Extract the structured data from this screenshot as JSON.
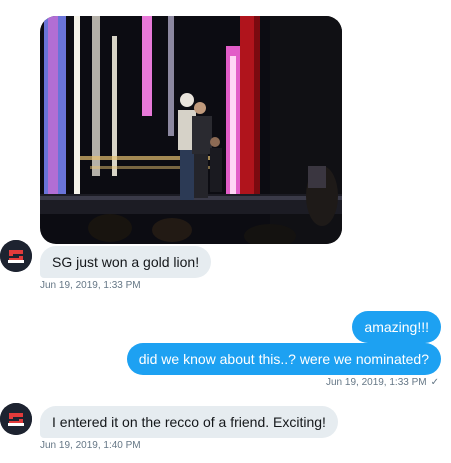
{
  "colors": {
    "incoming_bubble": "#e6ecf0",
    "outgoing_bubble": "#1da1f2",
    "timestamp": "#657786"
  },
  "messages": [
    {
      "direction": "incoming",
      "kind": "photo",
      "icon": "stage-photo"
    },
    {
      "direction": "incoming",
      "text": "SG just won a gold lion!"
    },
    {
      "direction": "incoming",
      "timestamp": "Jun 19, 2019, 1:33 PM"
    },
    {
      "direction": "outgoing",
      "text": "amazing!!!"
    },
    {
      "direction": "outgoing",
      "text": "did we know about this..? were we nominated?"
    },
    {
      "direction": "outgoing",
      "timestamp": "Jun 19, 2019, 1:33 PM",
      "status_icon": "check-icon"
    },
    {
      "direction": "incoming",
      "text": "I entered it on the recco of a friend. Exciting!"
    },
    {
      "direction": "incoming",
      "timestamp": "Jun 19, 2019, 1:40 PM"
    }
  ],
  "sender_avatar": {
    "icon": "sender-logo-avatar"
  }
}
